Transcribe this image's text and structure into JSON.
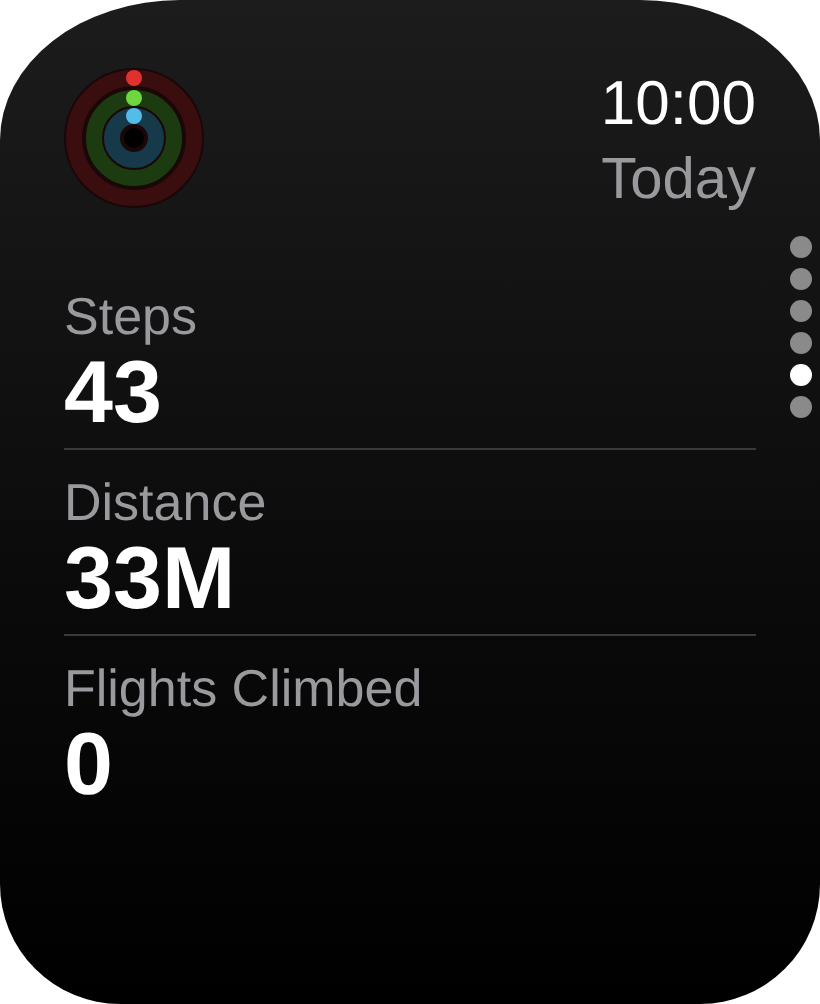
{
  "header": {
    "time": "10:00",
    "date": "Today"
  },
  "activity_rings": [
    {
      "kind": "move",
      "color": "#e2302f"
    },
    {
      "kind": "exercise",
      "color": "#6fd63d"
    },
    {
      "kind": "stand",
      "color": "#52bde8"
    }
  ],
  "metrics": [
    {
      "label": "Steps",
      "value": "43"
    },
    {
      "label": "Distance",
      "value": "33M"
    },
    {
      "label": "Flights Climbed",
      "value": "0"
    }
  ],
  "pages": [
    {
      "selected": false
    },
    {
      "selected": false
    },
    {
      "selected": false
    },
    {
      "selected": false
    },
    {
      "selected": true
    },
    {
      "selected": false
    }
  ]
}
